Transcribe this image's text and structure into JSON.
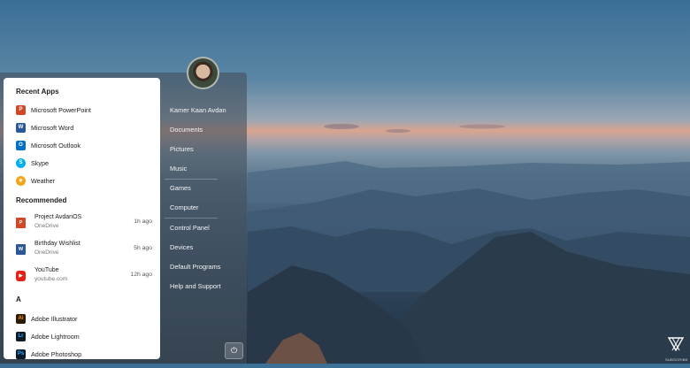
{
  "user": {
    "name": "Kamer Kaan Avdan"
  },
  "recent_apps": {
    "title": "Recent Apps",
    "items": [
      {
        "label": "Microsoft PowerPoint",
        "icon": "powerpoint-icon",
        "color": "#d24726",
        "glyph": "P"
      },
      {
        "label": "Microsoft Word",
        "icon": "word-icon",
        "color": "#2b579a",
        "glyph": "W"
      },
      {
        "label": "Microsoft Outlook",
        "icon": "outlook-icon",
        "color": "#0072c6",
        "glyph": "O"
      },
      {
        "label": "Skype",
        "icon": "skype-icon",
        "color": "#00aff0",
        "glyph": "S"
      },
      {
        "label": "Weather",
        "icon": "weather-icon",
        "color": "#f2a516",
        "glyph": "☀"
      }
    ]
  },
  "recommended": {
    "title": "Recommended",
    "items": [
      {
        "name": "Project AvdanOS",
        "sub": "OneDrive",
        "time": "1h ago",
        "icon": "powerpoint-file-icon",
        "color": "#d24726",
        "glyph": "P"
      },
      {
        "name": "Birthday Wishlist",
        "sub": "OneDrive",
        "time": "5h ago",
        "icon": "word-file-icon",
        "color": "#2b579a",
        "glyph": "W"
      },
      {
        "name": "YouTube",
        "sub": "youtube.com",
        "time": "12h ago",
        "icon": "youtube-icon",
        "color": "#e62117",
        "glyph": "▶"
      }
    ]
  },
  "alpha_section": {
    "letter": "A",
    "items": [
      {
        "label": "Adobe Illustrator",
        "icon": "illustrator-icon",
        "color": "#2b1a06",
        "glyph": "Ai",
        "fg": "#ff9a00"
      },
      {
        "label": "Adobe Lightroom",
        "icon": "lightroom-icon",
        "color": "#0a1a26",
        "glyph": "Lr",
        "fg": "#31a8ff"
      },
      {
        "label": "Adobe Photoshop",
        "icon": "photoshop-icon",
        "color": "#061a2b",
        "glyph": "Ps",
        "fg": "#31a8ff"
      }
    ]
  },
  "right_menu": [
    "Documents",
    "Pictures",
    "Music",
    "Games",
    "Computer",
    "Control Panel",
    "Devices",
    "Default Programs",
    "Help and Support"
  ],
  "watermark": {
    "text": "SUBSCRIBE"
  }
}
